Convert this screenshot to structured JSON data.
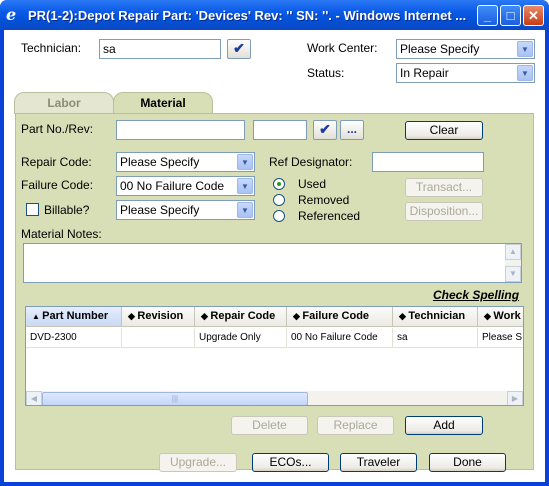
{
  "window": {
    "title": "PR(1-2):Depot Repair Part: 'Devices' Rev: '' SN: ''. - Windows Internet ...",
    "minimize_glyph": "_",
    "maximize_glyph": "□",
    "close_glyph": "✕"
  },
  "header": {
    "technician_label": "Technician:",
    "technician_value": "sa",
    "work_center_label": "Work Center:",
    "work_center_value": "Please Specify",
    "status_label": "Status:",
    "status_value": "In Repair"
  },
  "tabs": [
    {
      "label": "Labor",
      "active": false
    },
    {
      "label": "Material",
      "active": true
    }
  ],
  "material": {
    "part_no_label": "Part No./Rev:",
    "part_no_value": "",
    "rev_value": "",
    "lookup_glyph": "...",
    "clear_label": "Clear",
    "repair_code_label": "Repair Code:",
    "repair_code_value": "Please Specify",
    "failure_code_label": "Failure Code:",
    "failure_code_value": "00 No Failure Code",
    "billable_label": "Billable?",
    "billable_value": "Please Specify",
    "ref_designator_label": "Ref Designator:",
    "ref_designator_value": "",
    "radio_used": "Used",
    "radio_removed": "Removed",
    "radio_referenced": "Referenced",
    "selected_radio": "Used",
    "transact_label": "Transact...",
    "disposition_label": "Disposition...",
    "notes_label": "Material Notes:",
    "notes_value": "",
    "check_spelling_label": "Check Spelling"
  },
  "grid": {
    "columns": [
      "Part Number",
      "Revision",
      "Repair Code",
      "Failure Code",
      "Technician",
      "Work"
    ],
    "sorted_column": "Part Number",
    "rows": [
      [
        "DVD-2300",
        "",
        "Upgrade Only",
        "00 No Failure Code",
        "sa",
        "Please S"
      ]
    ]
  },
  "grid_actions": {
    "delete_label": "Delete",
    "replace_label": "Replace",
    "add_label": "Add"
  },
  "footer": {
    "upgrade_label": "Upgrade...",
    "ecos_label": "ECOs...",
    "traveler_label": "Traveler",
    "done_label": "Done"
  },
  "colors": {
    "titlebar": "#0a5ae8",
    "panel": "#d8dfb7",
    "button_border": "#003c74"
  }
}
